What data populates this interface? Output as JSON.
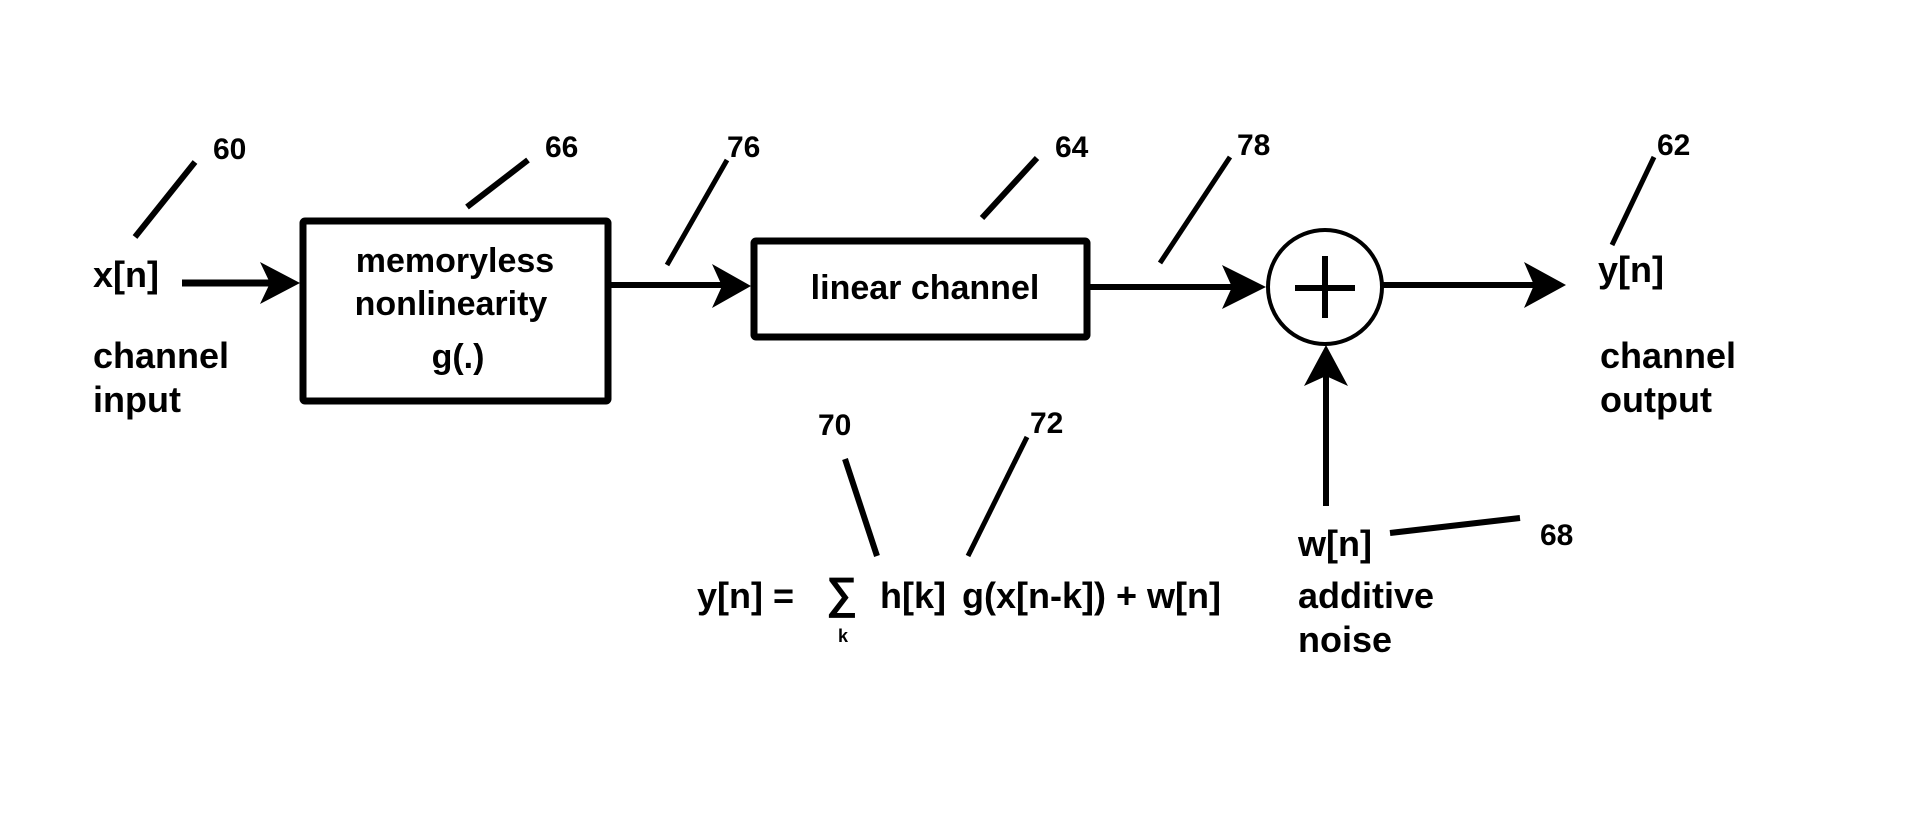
{
  "diagram": {
    "type": "block-diagram",
    "colors": {
      "ink": "#000000",
      "background": "#ffffff"
    },
    "input": {
      "signal": "x[n]",
      "caption_line1": "channel",
      "caption_line2": "input",
      "ref": "60"
    },
    "nonlinearity_block": {
      "line1": "memoryless",
      "line2": "nonlinearity",
      "line3": "g(.)",
      "ref": "66"
    },
    "link_after_nonlinearity": {
      "ref": "76"
    },
    "linear_block": {
      "label": "linear channel",
      "ref": "64"
    },
    "link_after_linear": {
      "ref": "78"
    },
    "summer": {
      "symbol": "+"
    },
    "noise": {
      "signal": "w[n]",
      "caption_line1": "additive",
      "caption_line2": "noise",
      "ref": "68"
    },
    "output": {
      "signal": "y[n]",
      "caption_line1": "channel",
      "caption_line2": "output",
      "ref": "62"
    },
    "equation": {
      "lhs": "y[n] =",
      "sum_symbol": "∑",
      "sum_index": "k",
      "term1": "h[k]",
      "term2": "g(x[n-k]) + w[n]",
      "ref_term1": "70",
      "ref_term2": "72"
    },
    "edges": [
      {
        "from": "input",
        "to": "nonlinearity_block"
      },
      {
        "from": "nonlinearity_block",
        "to": "linear_block"
      },
      {
        "from": "linear_block",
        "to": "summer"
      },
      {
        "from": "noise",
        "to": "summer"
      },
      {
        "from": "summer",
        "to": "output"
      }
    ]
  }
}
